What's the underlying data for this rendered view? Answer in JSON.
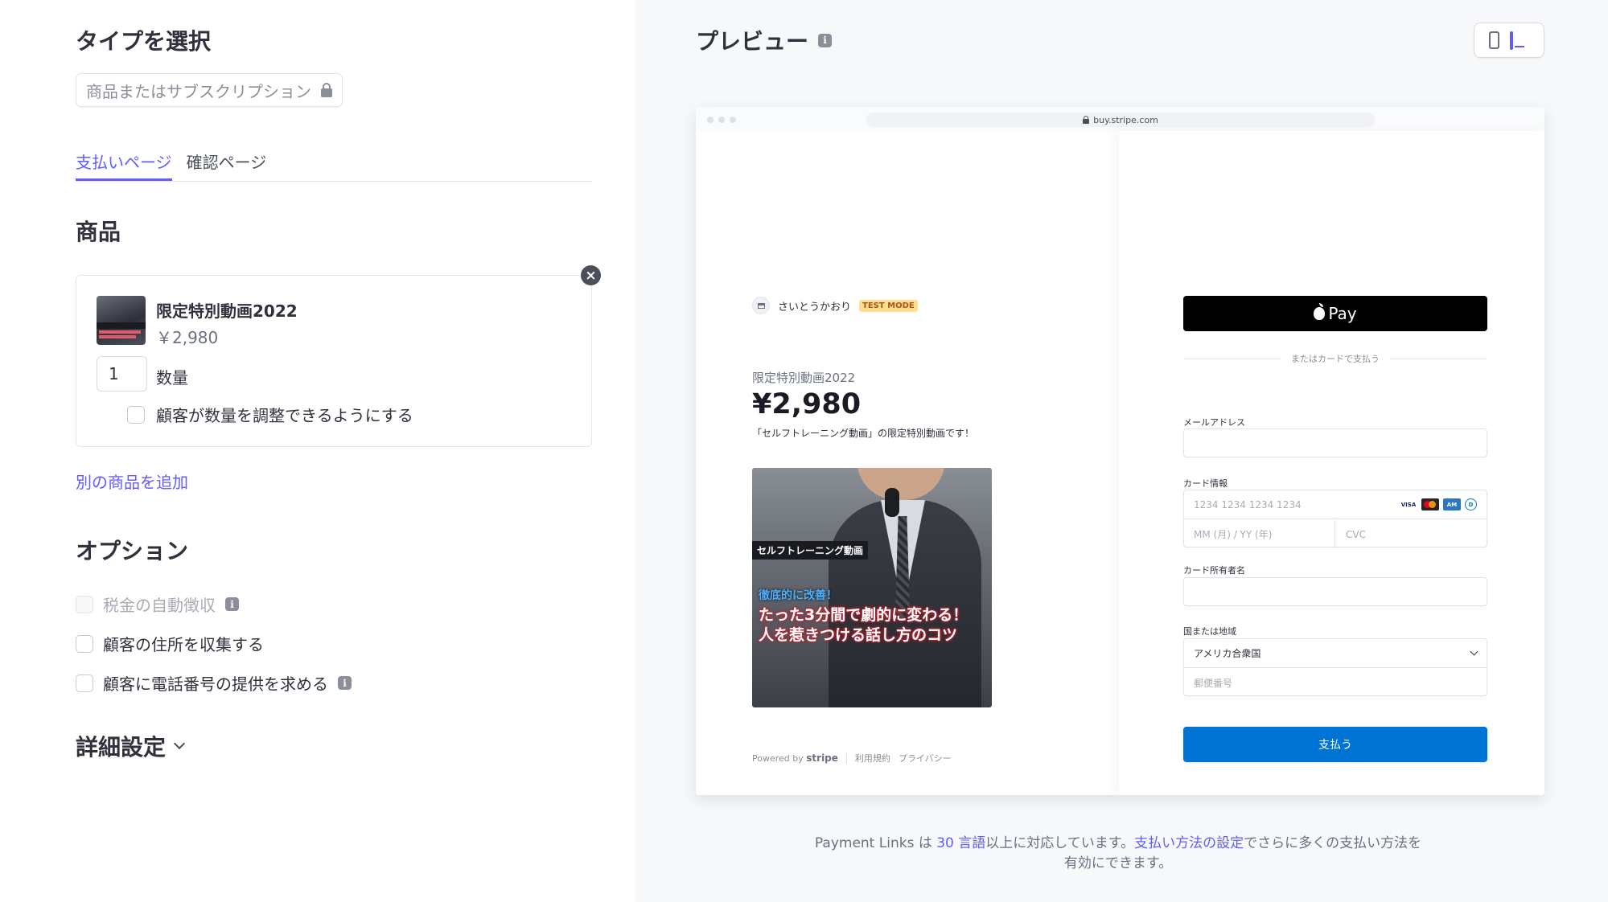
{
  "left": {
    "type_heading": "タイプを選択",
    "type_select": "商品またはサブスクリプション",
    "tabs": [
      {
        "label": "支払いページ"
      },
      {
        "label": "確認ページ"
      }
    ],
    "product_heading": "商品",
    "product": {
      "name": "限定特別動画2022",
      "price": "￥2,980",
      "quantity": "1",
      "quantity_label": "数量",
      "adjust_label": "顧客が数量を調整できるようにする"
    },
    "add_product_link": "別の商品を追加",
    "options_heading": "オプション",
    "options": [
      {
        "label": "税金の自動徴収"
      },
      {
        "label": "顧客の住所を収集する"
      },
      {
        "label": "顧客に電話番号の提供を求める"
      }
    ],
    "details_heading": "詳細設定"
  },
  "right": {
    "preview_heading": "プレビュー",
    "url": "buy.stripe.com",
    "checkout": {
      "merchant": "さいとうかおり",
      "test_mode": "TEST MODE",
      "product_name": "限定特別動画2022",
      "price": "¥2,980",
      "description": "「セルフトレーニング動画」の限定特別動画です！",
      "image_tag": "セルフトレーニング動画",
      "image_sub": "徹底的に改善！",
      "image_line1": "たった3分間で劇的に変わる！",
      "image_line2": "人を惹きつける話し方のコツ",
      "powered_by": "Powered by",
      "stripe": "stripe",
      "terms": "利用規約",
      "privacy": "プライバシー",
      "apple_pay": "Pay",
      "or_card": "またはカードで支払う",
      "email_label": "メールアドレス",
      "card_label": "カード情報",
      "card_placeholder": "1234 1234 1234 1234",
      "exp_placeholder": "MM (月) / YY (年)",
      "cvc_placeholder": "CVC",
      "holder_label": "カード所有者名",
      "country_label": "国または地域",
      "country_value": "アメリカ合衆国",
      "zip_placeholder": "郵便番号",
      "pay_button": "支払う"
    },
    "note": {
      "part1": "Payment Links は ",
      "link1": "30 言語",
      "part2": "以上に対応しています。",
      "link2": "支払い方法の設定",
      "part3": "でさらに多くの支払い方法を",
      "part4": "有効にできます。"
    }
  },
  "colors": {
    "accent": "#635bff",
    "pay_button": "#0074d4",
    "test_badge": "#ffde92"
  }
}
